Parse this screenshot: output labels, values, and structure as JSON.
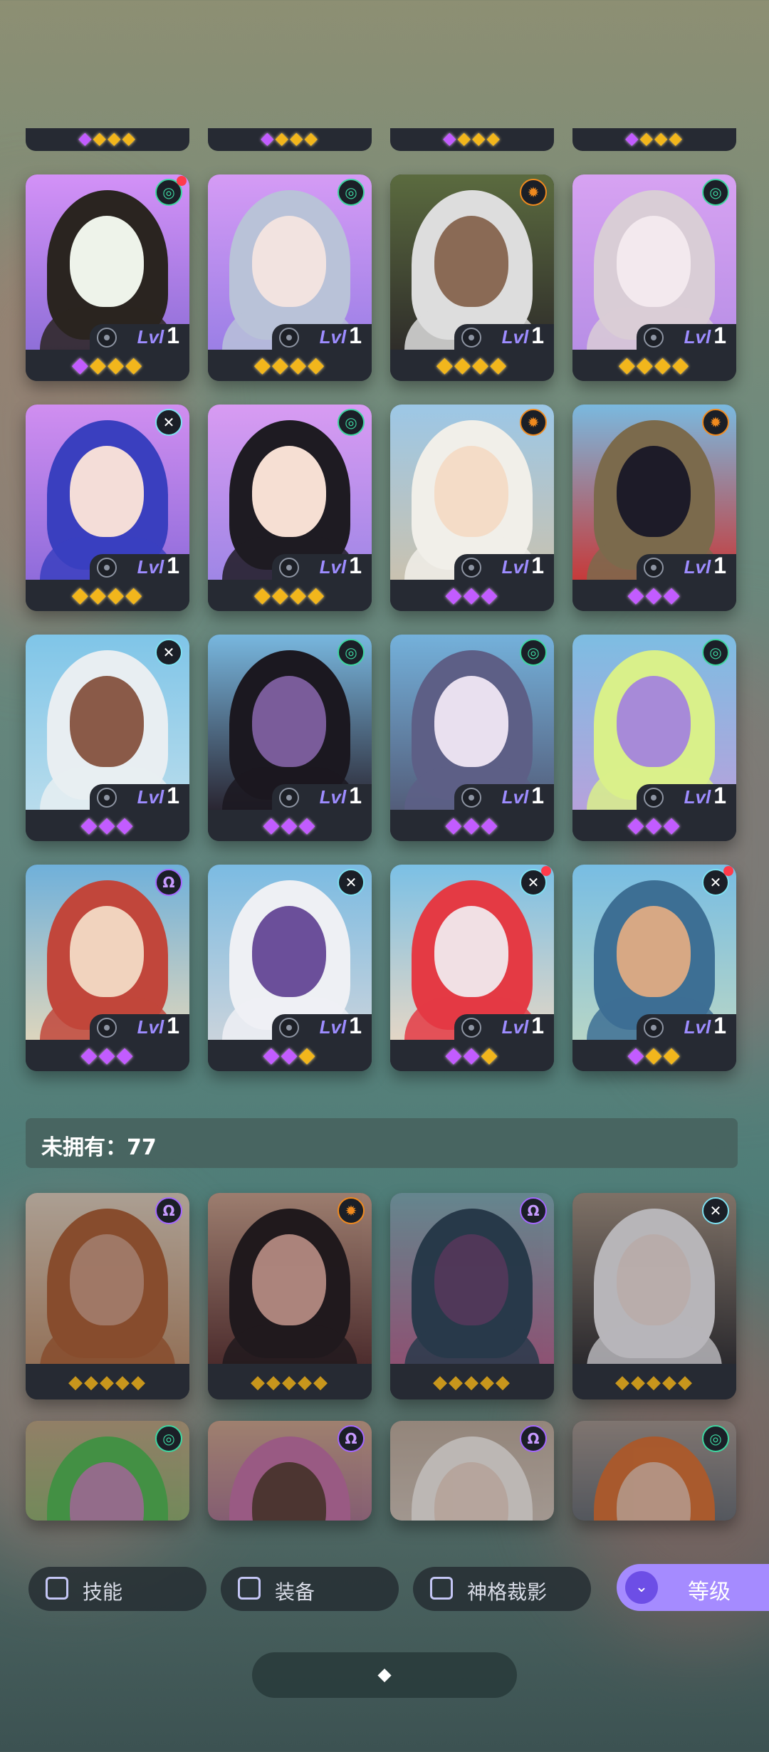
{
  "top_strip": [
    {
      "gems": [
        "p",
        "g",
        "g",
        "g"
      ]
    },
    {
      "gems": [
        "p",
        "g",
        "g",
        "g"
      ]
    },
    {
      "gems": [
        "p",
        "g",
        "g",
        "g"
      ]
    },
    {
      "gems": [
        "p",
        "g",
        "g",
        "g"
      ]
    }
  ],
  "owned": [
    {
      "name": "hero-1",
      "bg": [
        "#d391f7",
        "#8f6fd8"
      ],
      "skin": "#eef3ea",
      "hair": "#2a2420",
      "badge": "green",
      "badge_glyph": "◎",
      "dot": true,
      "lvl_prefix": "Lvl",
      "lvl": "1",
      "gems": [
        "p",
        "g",
        "g",
        "g"
      ]
    },
    {
      "name": "hero-2",
      "bg": [
        "#d59bf5",
        "#9b7fe6"
      ],
      "skin": "#f2e3e0",
      "hair": "#b9c2d8",
      "badge": "green",
      "badge_glyph": "◎",
      "dot": false,
      "lvl_prefix": "Lvl",
      "lvl": "1",
      "gems": [
        "g",
        "g",
        "g",
        "g"
      ]
    },
    {
      "name": "hero-3",
      "bg": [
        "#5b6b3f",
        "#2f2d2a"
      ],
      "skin": "#8a6a55",
      "hair": "#dddddd",
      "badge": "orange",
      "badge_glyph": "✹",
      "dot": false,
      "lvl_prefix": "Lvl",
      "lvl": "1",
      "gems": [
        "g",
        "g",
        "g",
        "g"
      ]
    },
    {
      "name": "hero-4",
      "bg": [
        "#d7a2f2",
        "#b88fe6"
      ],
      "skin": "#f3e9ee",
      "hair": "#d9cdd6",
      "badge": "green",
      "badge_glyph": "◎",
      "dot": false,
      "lvl_prefix": "Lvl",
      "lvl": "1",
      "gems": [
        "g",
        "g",
        "g",
        "g"
      ]
    },
    {
      "name": "hero-5",
      "bg": [
        "#d08ef0",
        "#8f6cdb"
      ],
      "skin": "#f4ddd8",
      "hair": "#3a3fbf",
      "badge": "cyan",
      "badge_glyph": "✕",
      "dot": false,
      "lvl_prefix": "Lvl",
      "lvl": "1",
      "gems": [
        "g",
        "g",
        "g",
        "g"
      ]
    },
    {
      "name": "hero-6",
      "bg": [
        "#d89bf2",
        "#9f86e6"
      ],
      "skin": "#f6dfd3",
      "hair": "#1e1b22",
      "badge": "green",
      "badge_glyph": "◎",
      "dot": false,
      "lvl_prefix": "Lvl",
      "lvl": "1",
      "gems": [
        "g",
        "g",
        "g",
        "g"
      ]
    },
    {
      "name": "hero-7",
      "bg": [
        "#9cc7e6",
        "#c9c2b0"
      ],
      "skin": "#f4dcc7",
      "hair": "#f1efe9",
      "badge": "orange",
      "badge_glyph": "✹",
      "dot": false,
      "lvl_prefix": "Lvl",
      "lvl": "1",
      "gems": [
        "p",
        "p",
        "p"
      ]
    },
    {
      "name": "hero-8",
      "bg": [
        "#7ab9df",
        "#c63a3a"
      ],
      "skin": "#1d1b28",
      "hair": "#7b6a4c",
      "badge": "orange",
      "badge_glyph": "✹",
      "dot": false,
      "lvl_prefix": "Lvl",
      "lvl": "1",
      "gems": [
        "p",
        "p",
        "p"
      ]
    },
    {
      "name": "hero-9",
      "bg": [
        "#7fc5e8",
        "#b8dcec"
      ],
      "skin": "#8a5a48",
      "hair": "#e8eef2",
      "badge": "cyan",
      "badge_glyph": "✕",
      "dot": false,
      "lvl_prefix": "Lvl",
      "lvl": "1",
      "gems": [
        "p",
        "p",
        "p"
      ]
    },
    {
      "name": "hero-10",
      "bg": [
        "#78b7df",
        "#2a2632"
      ],
      "skin": "#7a5c9a",
      "hair": "#1b1820",
      "badge": "green",
      "badge_glyph": "◎",
      "dot": false,
      "lvl_prefix": "Lvl",
      "lvl": "1",
      "gems": [
        "p",
        "p",
        "p"
      ]
    },
    {
      "name": "hero-11",
      "bg": [
        "#74b1db",
        "#535d7a"
      ],
      "skin": "#e9e0ef",
      "hair": "#5d5f86",
      "badge": "green",
      "badge_glyph": "◎",
      "dot": false,
      "lvl_prefix": "Lvl",
      "lvl": "1",
      "gems": [
        "p",
        "p",
        "p"
      ]
    },
    {
      "name": "hero-12",
      "bg": [
        "#7dbde2",
        "#b6a2dc"
      ],
      "skin": "#a78ad8",
      "hair": "#d9f08a",
      "badge": "green",
      "badge_glyph": "◎",
      "dot": false,
      "lvl_prefix": "Lvl",
      "lvl": "1",
      "gems": [
        "p",
        "p",
        "p"
      ]
    },
    {
      "name": "hero-13",
      "bg": [
        "#6fb0da",
        "#dcd5bd"
      ],
      "skin": "#f1d3be",
      "hair": "#c1463b",
      "badge": "purple",
      "badge_glyph": "Ω",
      "dot": false,
      "lvl_prefix": "Lvl",
      "lvl": "1",
      "gems": [
        "p",
        "p",
        "p"
      ]
    },
    {
      "name": "hero-14",
      "bg": [
        "#7bbbe2",
        "#c9d3dc"
      ],
      "skin": "#6b4f9a",
      "hair": "#eef0f4",
      "badge": "cyan",
      "badge_glyph": "✕",
      "dot": false,
      "lvl_prefix": "Lvl",
      "lvl": "1",
      "gems": [
        "p",
        "p",
        "g"
      ]
    },
    {
      "name": "hero-15",
      "bg": [
        "#7bc0e5",
        "#e3d6c6"
      ],
      "skin": "#f1e0e4",
      "hair": "#e43a44",
      "badge": "cyan",
      "badge_glyph": "✕",
      "dot": true,
      "lvl_prefix": "Lvl",
      "lvl": "1",
      "gems": [
        "p",
        "p",
        "g"
      ]
    },
    {
      "name": "hero-16",
      "bg": [
        "#78bde3",
        "#b6d5c7"
      ],
      "skin": "#d7a884",
      "hair": "#3d6f94",
      "badge": "cyan",
      "badge_glyph": "✕",
      "dot": true,
      "lvl_prefix": "Lvl",
      "lvl": "1",
      "gems": [
        "p",
        "g",
        "g"
      ]
    }
  ],
  "unowned_label": "未拥有：77",
  "unowned": [
    {
      "name": "locked-hero-1",
      "bg": [
        "#d9c7b4",
        "#b88a66"
      ],
      "skin": "#c99378",
      "hair": "#a8582c",
      "badge": "purple",
      "badge_glyph": "Ω",
      "gems": [
        "g",
        "g",
        "g",
        "g",
        "g"
      ]
    },
    {
      "name": "locked-hero-2",
      "bg": [
        "#c59a84",
        "#5a2e2c"
      ],
      "skin": "#d9a295",
      "hair": "#1f1416",
      "badge": "orange",
      "badge_glyph": "✹",
      "gems": [
        "g",
        "g",
        "g",
        "g",
        "g"
      ]
    },
    {
      "name": "locked-hero-3",
      "bg": [
        "#7aa6ae",
        "#b05f88"
      ],
      "skin": "#5f3d66",
      "hair": "#293f52",
      "badge": "purple",
      "badge_glyph": "Ω",
      "gems": [
        "g",
        "g",
        "g",
        "g",
        "g"
      ]
    },
    {
      "name": "locked-hero-4",
      "bg": [
        "#9d8a79",
        "#2d2a2c"
      ],
      "skin": "#ead9d3",
      "hair": "#e8e4e6",
      "badge": "cyan",
      "badge_glyph": "✕",
      "gems": [
        "g",
        "g",
        "g",
        "g",
        "g"
      ]
    },
    {
      "name": "locked-hero-5",
      "bg": [
        "#b79d7a",
        "#6fb35c"
      ],
      "skin": "#b883a8",
      "hair": "#4eb34b",
      "badge": "green",
      "badge_glyph": "◎"
    },
    {
      "name": "locked-hero-6",
      "bg": [
        "#c89e84",
        "#8c4f8a"
      ],
      "skin": "#5a3a32",
      "hair": "#c06b9f",
      "badge": "purple",
      "badge_glyph": "Ω"
    },
    {
      "name": "locked-hero-7",
      "bg": [
        "#b9a594",
        "#d8ccc2"
      ],
      "skin": "#e7cfc1",
      "hair": "#efe7e0",
      "badge": "purple",
      "badge_glyph": "Ω"
    },
    {
      "name": "locked-hero-8",
      "bg": [
        "#9e8f86",
        "#3a4a5a"
      ],
      "skin": "#e2b49a",
      "hair": "#d56a2c",
      "badge": "green",
      "badge_glyph": "◎"
    }
  ],
  "filters": [
    {
      "label": "技能"
    },
    {
      "label": "装备"
    },
    {
      "label": "神格裁影"
    }
  ],
  "sort": {
    "label": "等级",
    "chevron": "⌄"
  },
  "collapse": {
    "icon": "diamond-grid-icon",
    "glyph": "⬥"
  }
}
